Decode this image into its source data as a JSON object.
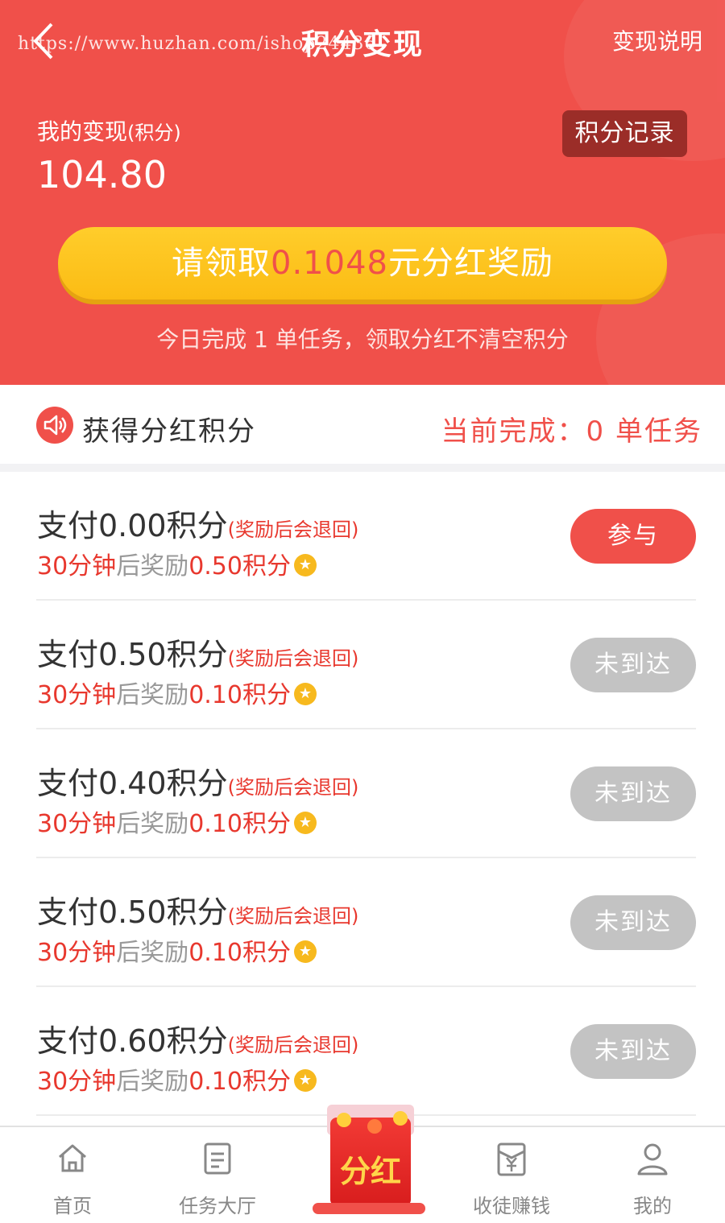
{
  "header": {
    "title": "积分变现",
    "watermark": "https://www.huzhan.com/ishop24436",
    "explain_link": "变现说明",
    "my_label": "我的变现",
    "my_unit": "(积分)",
    "balance": "104.80",
    "record_button": "积分记录",
    "claim": {
      "prefix": "请领取",
      "amount": "0.1048",
      "suffix": "元分红奖励"
    },
    "note": "今日完成 1 单任务，领取分红不清空积分"
  },
  "section": {
    "title": "获得分红积分",
    "status": "当前完成：0 单任务"
  },
  "tasks": [
    {
      "pay": "支付0.00积分",
      "note": "(奖励后会退回)",
      "time": "30分钟",
      "after": "后奖励",
      "reward": "0.50积分",
      "button": "参与",
      "state": "active"
    },
    {
      "pay": "支付0.50积分",
      "note": "(奖励后会退回)",
      "time": "30分钟",
      "after": "后奖励",
      "reward": "0.10积分",
      "button": "未到达",
      "state": "disabled"
    },
    {
      "pay": "支付0.40积分",
      "note": "(奖励后会退回)",
      "time": "30分钟",
      "after": "后奖励",
      "reward": "0.10积分",
      "button": "未到达",
      "state": "disabled"
    },
    {
      "pay": "支付0.50积分",
      "note": "(奖励后会退回)",
      "time": "30分钟",
      "after": "后奖励",
      "reward": "0.10积分",
      "button": "未到达",
      "state": "disabled"
    },
    {
      "pay": "支付0.60积分",
      "note": "(奖励后会退回)",
      "time": "30分钟",
      "after": "后奖励",
      "reward": "0.10积分",
      "button": "未到达",
      "state": "disabled"
    }
  ],
  "tabbar": {
    "home": "首页",
    "tasks": "任务大厅",
    "center": "分红",
    "invite": "收徒赚钱",
    "me": "我的"
  },
  "colors": {
    "brand_red": "#f0504a",
    "gold": "#fbbc14",
    "disabled_grey": "#c3c3c3"
  }
}
